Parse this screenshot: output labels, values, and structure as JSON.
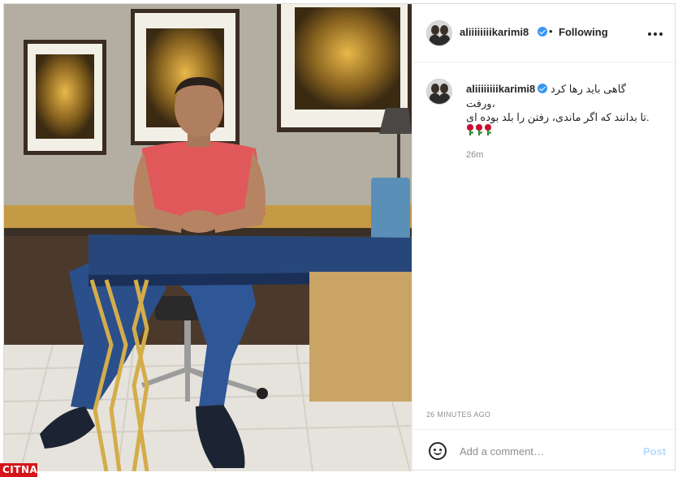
{
  "post": {
    "username": "aliiiiiiiikarimi8",
    "verified": true,
    "separator": "•",
    "follow_status": "Following",
    "more_icon": "more-horizontal-icon"
  },
  "caption": {
    "username": "aliiiiiiiikarimi8",
    "lines": [
      "گاهی باید رها کرد",
      "،ورفت",
      ".تا بدانند که اگر ماندی، رفتن را بلد بوده ای"
    ],
    "emoji": [
      "rose",
      "rose",
      "rose"
    ],
    "relative_time": "26m"
  },
  "timestamp": "26 MINUTES AGO",
  "comment": {
    "emoji_icon": "smiley-icon",
    "placeholder": "Add a comment…",
    "post_label": "Post"
  },
  "colors": {
    "verified": "#3897f0",
    "post_button_disabled": "#b3dbff",
    "muted_text": "#8e8e8e",
    "border": "#efefef"
  },
  "watermark": {
    "text": "CITNA"
  }
}
